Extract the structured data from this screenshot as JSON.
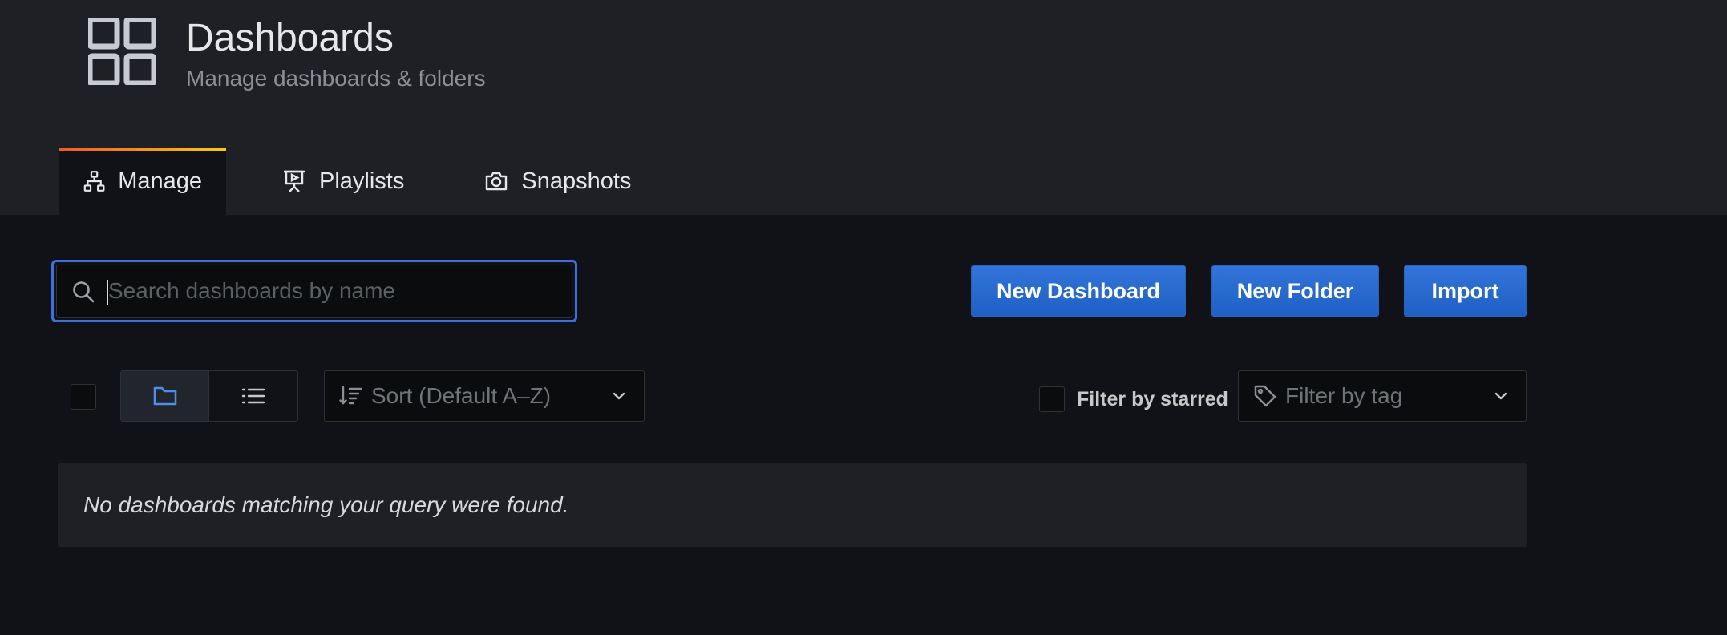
{
  "header": {
    "title": "Dashboards",
    "subtitle": "Manage dashboards & folders",
    "icon": "apps-grid-icon"
  },
  "tabs": [
    {
      "label": "Manage",
      "icon": "sitemap-icon",
      "active": true
    },
    {
      "label": "Playlists",
      "icon": "presentation-play-icon",
      "active": false
    },
    {
      "label": "Snapshots",
      "icon": "camera-icon",
      "active": false
    }
  ],
  "search": {
    "placeholder": "Search dashboards by name",
    "value": ""
  },
  "actions": {
    "new_dashboard": "New Dashboard",
    "new_folder": "New Folder",
    "import": "Import"
  },
  "filters": {
    "sort_placeholder": "Sort (Default A–Z)",
    "starred_label": "Filter by starred",
    "tag_placeholder": "Filter by tag",
    "view_mode": "folders"
  },
  "results": {
    "empty_message": "No dashboards matching your query were found."
  },
  "colors": {
    "accent_blue": "#3274d9",
    "tab_gradient_start": "#f05a28",
    "tab_gradient_end": "#fbca0a",
    "folder_icon_active": "#4c8ee8"
  }
}
